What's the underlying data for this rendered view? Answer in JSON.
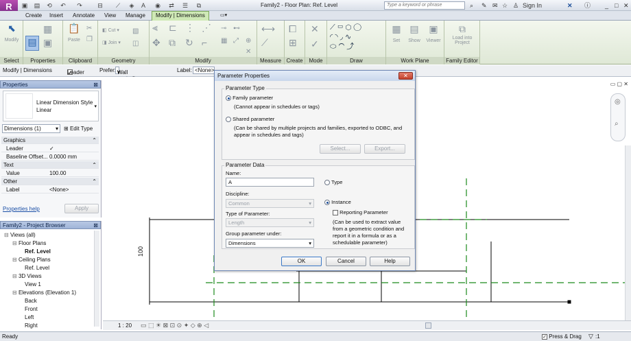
{
  "app": {
    "doc_title": "Family2 - Floor Plan: Ref. Level",
    "search_placeholder": "Type a keyword or phrase",
    "sign_in": "Sign In"
  },
  "tabs": [
    "Create",
    "Insert",
    "Annotate",
    "View",
    "Manage",
    "Modify | Dimensions"
  ],
  "active_tab": "Modify | Dimensions",
  "ribbon": {
    "panels": [
      "Select",
      "Properties",
      "Clipboard",
      "Geometry",
      "Modify",
      "Measure",
      "Create",
      "Mode",
      "Draw",
      "Work Plane",
      "Family Editor"
    ],
    "buttons": {
      "modify": "Modify",
      "paste": "Paste",
      "cut": "Cut",
      "join": "Join",
      "set": "Set",
      "show": "Show",
      "viewer": "Viewer",
      "load_into_project": "Load into Project"
    }
  },
  "options_bar": {
    "context": "Modify | Dimensions",
    "leader_label": "Leader",
    "leader_checked": true,
    "prefer_label": "Prefer:",
    "prefer_value": "Wall centerlines",
    "label_label": "Label:",
    "label_value": "<None>"
  },
  "properties": {
    "title": "Properties",
    "type_name": "Linear Dimension Style",
    "type_sub": "Linear",
    "instance_filter": "Dimensions (1)",
    "edit_type": "Edit Type",
    "rows": [
      {
        "kind": "group",
        "label": "Graphics"
      },
      {
        "kind": "row",
        "label": "Leader",
        "value": "✓"
      },
      {
        "kind": "row",
        "label": "Baseline Offset...",
        "value": "0.0000 mm"
      },
      {
        "kind": "group",
        "label": "Text"
      },
      {
        "kind": "row",
        "label": "Value",
        "value": "100.00"
      },
      {
        "kind": "group",
        "label": "Other"
      },
      {
        "kind": "row",
        "label": "Label",
        "value": "<None>"
      }
    ],
    "help_link": "Properties help",
    "apply": "Apply"
  },
  "browser": {
    "title": "Family2 - Project Browser",
    "items": [
      {
        "label": "Views (all)",
        "level": 0
      },
      {
        "label": "Floor Plans",
        "level": 1
      },
      {
        "label": "Ref. Level",
        "level": 2,
        "bold": true
      },
      {
        "label": "Ceiling Plans",
        "level": 1
      },
      {
        "label": "Ref. Level",
        "level": 2
      },
      {
        "label": "3D Views",
        "level": 1
      },
      {
        "label": "View 1",
        "level": 2
      },
      {
        "label": "Elevations (Elevation 1)",
        "level": 1
      },
      {
        "label": "Back",
        "level": 2
      },
      {
        "label": "Front",
        "level": 2
      },
      {
        "label": "Left",
        "level": 2
      },
      {
        "label": "Right",
        "level": 2
      }
    ]
  },
  "drawing": {
    "dimension_text": "100",
    "scale": "1 : 20"
  },
  "dialog": {
    "title": "Parameter Properties",
    "param_type_group": "Parameter Type",
    "family_param": "Family parameter",
    "family_param_note": "(Cannot appear in schedules or tags)",
    "shared_param": "Shared parameter",
    "shared_param_note": "(Can be shared by multiple projects and families, exported to ODBC, and appear in schedules and tags)",
    "select_btn": "Select...",
    "export_btn": "Export...",
    "param_data_group": "Parameter Data",
    "name_label": "Name:",
    "name_value": "A",
    "type_radio": "Type",
    "instance_radio": "Instance",
    "reporting": "Reporting Parameter",
    "reporting_note": "(Can be used to extract value from a geometric condition and report it in a formula or as a schedulable parameter)",
    "discipline_label": "Discipline:",
    "discipline_value": "Common",
    "type_of_param_label": "Type of Parameter:",
    "type_of_param_value": "Length",
    "group_under_label": "Group parameter under:",
    "group_under_value": "Dimensions",
    "ok": "OK",
    "cancel": "Cancel",
    "help": "Help"
  },
  "status": {
    "text": "Ready",
    "press_drag": "Press & Drag",
    "filter_count": ":1"
  }
}
